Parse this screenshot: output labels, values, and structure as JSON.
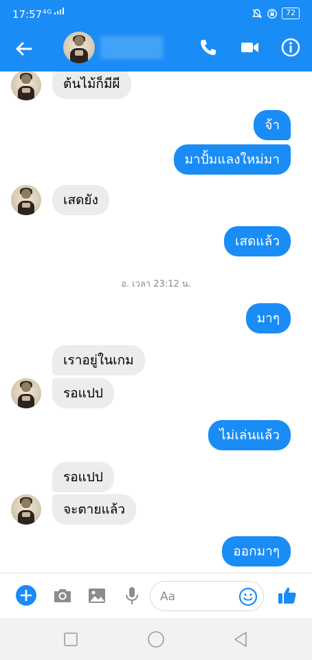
{
  "status_bar": {
    "time": "17:57",
    "network": "4G",
    "battery": "72"
  },
  "header": {
    "contact_name_hidden": true
  },
  "messages": [
    {
      "id": "m1",
      "direction": "incoming",
      "text": "ต้นไม้ก็มีผี"
    },
    {
      "id": "m2",
      "direction": "outgoing",
      "text": "จ้า"
    },
    {
      "id": "m3",
      "direction": "outgoing",
      "text": "มาปั้มแลงใหม่มา"
    },
    {
      "id": "m4",
      "direction": "incoming",
      "text": "เสดยัง"
    },
    {
      "id": "m5",
      "direction": "outgoing",
      "text": "เสดแล้ว"
    },
    {
      "id": "ts",
      "type": "timestamp",
      "text": "อ. เวลา 23:12 น."
    },
    {
      "id": "m6",
      "direction": "outgoing",
      "text": "มาๆ"
    },
    {
      "id": "m7",
      "direction": "incoming",
      "text": "เราอยู่ในเกม"
    },
    {
      "id": "m8",
      "direction": "incoming",
      "text": "รอแปป"
    },
    {
      "id": "m9",
      "direction": "outgoing",
      "text": "ไม่เล่นแล้ว"
    },
    {
      "id": "m10",
      "direction": "incoming",
      "text": "รอแปป"
    },
    {
      "id": "m11",
      "direction": "incoming",
      "text": "จะตายแล้ว"
    },
    {
      "id": "m12",
      "direction": "outgoing",
      "text": "ออกมาๆ"
    }
  ],
  "composer": {
    "placeholder": "Aa"
  },
  "colors": {
    "brand_blue": "#1a8cf5",
    "incoming_bubble": "#ececec"
  },
  "icons": {
    "header": [
      "back-arrow-icon",
      "phone-icon",
      "video-camera-icon",
      "info-icon"
    ],
    "composer": [
      "plus-icon",
      "camera-icon",
      "image-icon",
      "microphone-icon",
      "emoji-icon",
      "thumbs-up-icon"
    ],
    "nav": [
      "recents-square-icon",
      "home-circle-icon",
      "back-triangle-icon"
    ]
  }
}
